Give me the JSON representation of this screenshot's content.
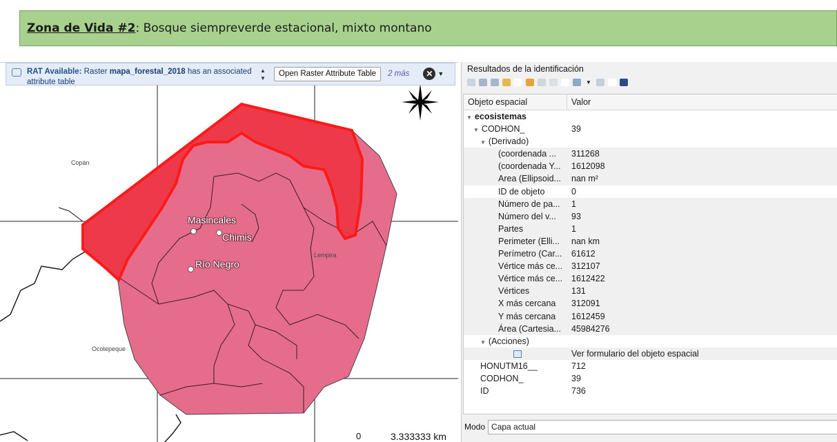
{
  "banner": {
    "bold": "Zona de Vida #2",
    "rest": ": Bosque siempreverde estacional, mixto montano",
    "background": "#a9d18e"
  },
  "messagebar": {
    "title": "RAT Available:",
    "text_before": " Raster ",
    "layer": "mapa_forestal_2018",
    "text_after": " has an associated attribute table",
    "button": "Open Raster Attribute Table",
    "more": "2 más"
  },
  "map": {
    "labels": {
      "copan": "Copán",
      "lempira": "Lempira",
      "ocotepeque": "Ocotepeque"
    },
    "towns": [
      "Masincales",
      "Chimis",
      "Río Negro"
    ],
    "scale": {
      "zero": "0",
      "value": "3.333333 km"
    },
    "colors": {
      "fill": "#e56d8b",
      "highlight": "#ff1a1a",
      "outline": "#333333"
    }
  },
  "panel": {
    "title": "Resultados de la identificación",
    "headers": {
      "feature": "Objeto espacial",
      "value": "Valor"
    },
    "rows": [
      {
        "indent": 0,
        "tw": "▼",
        "field": "ecosistemas",
        "value": "",
        "bold": true
      },
      {
        "indent": 1,
        "tw": "▼",
        "field": "CODHON_",
        "value": "39"
      },
      {
        "indent": 2,
        "tw": "▼",
        "field": "(Derivado)",
        "value": ""
      },
      {
        "indent": 3,
        "field": "(coordenada ...",
        "value": "311268",
        "shade": true
      },
      {
        "indent": 3,
        "field": "(coordenada Y...",
        "value": "1612098",
        "shade": true
      },
      {
        "indent": 3,
        "field": "Area (Ellipsoid...",
        "value": "nan m²",
        "shade": true
      },
      {
        "indent": 3,
        "field": "ID de objeto",
        "value": "0"
      },
      {
        "indent": 3,
        "field": "Número de pa...",
        "value": "1",
        "shade": true
      },
      {
        "indent": 3,
        "field": "Número del v...",
        "value": "93",
        "shade": true
      },
      {
        "indent": 3,
        "field": "Partes",
        "value": "1",
        "shade": true
      },
      {
        "indent": 3,
        "field": "Perimeter (Elli...",
        "value": "nan km",
        "shade": true
      },
      {
        "indent": 3,
        "field": "Perímetro (Car...",
        "value": "61612",
        "shade": true
      },
      {
        "indent": 3,
        "field": "Vértice más ce...",
        "value": "312107",
        "shade": true
      },
      {
        "indent": 3,
        "field": "Vértice más ce...",
        "value": "1612422",
        "shade": true
      },
      {
        "indent": 3,
        "field": "Vértices",
        "value": "131",
        "shade": true
      },
      {
        "indent": 3,
        "field": "X más cercana",
        "value": "312091",
        "shade": true
      },
      {
        "indent": 3,
        "field": "Y más cercana",
        "value": "1612459",
        "shade": true
      },
      {
        "indent": 3,
        "field": "Área (Cartesia...",
        "value": "45984276",
        "shade": true
      },
      {
        "indent": 2,
        "tw": "▼",
        "field": "(Acciones)",
        "value": ""
      },
      {
        "indent": 3,
        "icon": true,
        "field": "",
        "value": "Ver formulario del objeto espacial",
        "shade": true
      },
      {
        "indent": 2,
        "field": "HONUTM16__",
        "value": "712"
      },
      {
        "indent": 2,
        "field": "CODHON_",
        "value": "39"
      },
      {
        "indent": 2,
        "field": "ID",
        "value": "736"
      }
    ],
    "mode_label": "Modo",
    "mode_value": "Capa actual"
  }
}
